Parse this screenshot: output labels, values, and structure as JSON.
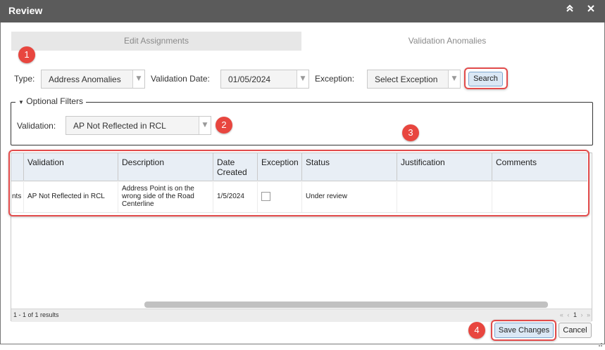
{
  "window": {
    "title": "Review",
    "colors": {
      "titlebar": "#5b5b5b",
      "accent_red": "#e24b4b",
      "button_blue": "#dbe8f5"
    }
  },
  "tabs": [
    {
      "label": "Edit Assignments",
      "active": false
    },
    {
      "label": "Validation Anomalies",
      "active": true
    }
  ],
  "filters": {
    "type_label": "Type:",
    "type_value": "Address Anomalies",
    "date_label": "Validation Date:",
    "date_value": "01/05/2024",
    "exception_label": "Exception:",
    "exception_value": "Select Exception",
    "search_label": "Search"
  },
  "optional": {
    "legend": "Optional Filters",
    "validation_label": "Validation:",
    "validation_value": "AP Not Reflected in RCL"
  },
  "grid": {
    "columns": [
      "Validation",
      "Description",
      "Date Created",
      "Exception",
      "Status",
      "Justification",
      "Comments"
    ],
    "rows": [
      {
        "first_fragment": "nts",
        "validation": "AP Not Reflected in RCL",
        "description": "Address Point is on the wrong side of the Road Centerline",
        "date_created": "1/5/2024",
        "exception_checked": false,
        "status": "Under review",
        "justification": "",
        "comments": ""
      }
    ],
    "results_text": "1 - 1 of 1 results",
    "pager": {
      "first": "«",
      "prev": "‹",
      "page": "1",
      "next": "›",
      "last": "»"
    }
  },
  "actions": {
    "save_label": "Save Changes",
    "cancel_label": "Cancel"
  },
  "badges": [
    "1",
    "2",
    "3",
    "4"
  ]
}
